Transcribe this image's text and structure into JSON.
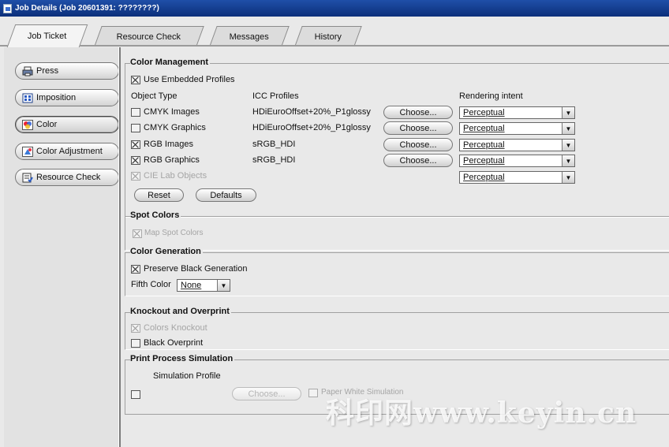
{
  "window": {
    "title": "Job Details (Job 20601391: ????????)"
  },
  "tabs": [
    "Job Ticket",
    "Resource Check",
    "Messages",
    "History"
  ],
  "sidebar": {
    "items": [
      {
        "label": "Press",
        "icon": "printer-icon"
      },
      {
        "label": "Imposition",
        "icon": "imposition-icon"
      },
      {
        "label": "Color",
        "icon": "color-wheel-icon",
        "active": true
      },
      {
        "label": "Color Adjustment",
        "icon": "color-adjustment-icon"
      },
      {
        "label": "Resource Check",
        "icon": "resource-check-icon"
      }
    ]
  },
  "color_management": {
    "title": "Color Management",
    "use_embedded_label": "Use Embedded Profiles",
    "headers": {
      "object_type": "Object Type",
      "icc_profiles": "ICC Profiles",
      "rendering_intent": "Rendering intent"
    },
    "rows": [
      {
        "label": "CMYK Images",
        "checked": false,
        "profile": "HDiEuroOffset+20%_P1glossy",
        "choose": "Choose...",
        "intent": "Perceptual"
      },
      {
        "label": "CMYK Graphics",
        "checked": false,
        "profile": "HDiEuroOffset+20%_P1glossy",
        "choose": "Choose...",
        "intent": "Perceptual"
      },
      {
        "label": "RGB Images",
        "checked": true,
        "profile": "sRGB_HDI",
        "choose": "Choose...",
        "intent": "Perceptual"
      },
      {
        "label": "RGB Graphics",
        "checked": true,
        "profile": "sRGB_HDI",
        "choose": "Choose...",
        "intent": "Perceptual"
      },
      {
        "label": "CIE Lab Objects",
        "checked": true,
        "disabled": true,
        "intent": "Perceptual"
      }
    ],
    "reset_label": "Reset",
    "defaults_label": "Defaults"
  },
  "spot_colors": {
    "title": "Spot Colors",
    "map_label": "Map Spot Colors"
  },
  "color_generation": {
    "title": "Color Generation",
    "preserve_black_label": "Preserve Black Generation",
    "fifth_color_label": "Fifth Color",
    "fifth_color_value": "None"
  },
  "knockout": {
    "title": "Knockout and Overprint",
    "colors_knockout_label": "Colors Knockout",
    "black_overprint_label": "Black Overprint"
  },
  "simulation": {
    "title": "Print Process Simulation",
    "profile_label": "Simulation Profile",
    "choose": "Choose...",
    "paper_white_label": "Paper White Simulation"
  },
  "watermark": "科印网www.keyin.cn"
}
